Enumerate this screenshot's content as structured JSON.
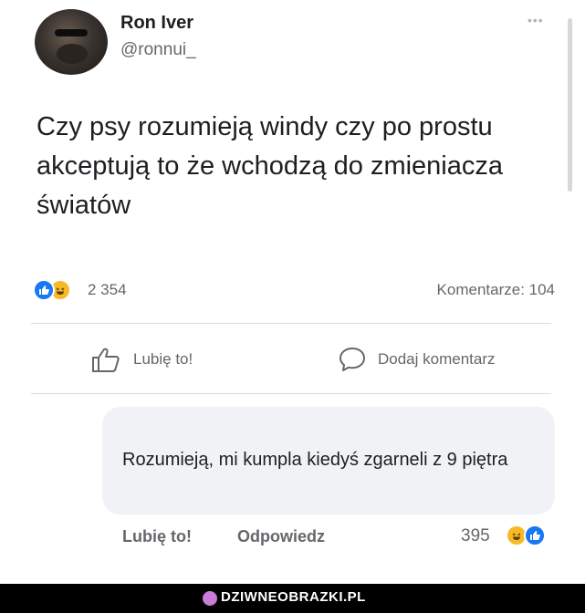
{
  "post": {
    "author_name": "Ron Iver",
    "author_handle": "@ronnui_",
    "text": "Czy psy rozumieją windy czy po prostu akceptują to że wchodzą do zmieniacza światów",
    "reaction_count": "2 354",
    "comments_label": "Komentarze: 104",
    "actions": {
      "like_label": "Lubię to!",
      "comment_label": "Dodaj komentarz"
    },
    "menu_icon": "more-dots-icon"
  },
  "comment": {
    "text": "Rozumieją, mi kumpla kiedyś zgarneli z 9 piętra",
    "like_label": "Lubię to!",
    "reply_label": "Odpowiedz",
    "reaction_count": "395"
  },
  "footer": {
    "watermark": "DZIWNEOBRAZKI.PL"
  },
  "colors": {
    "like_blue": "#1877f2",
    "haha_yellow": "#f7b928",
    "muted_text": "#65676b",
    "bubble_bg": "#f0f2f5"
  }
}
